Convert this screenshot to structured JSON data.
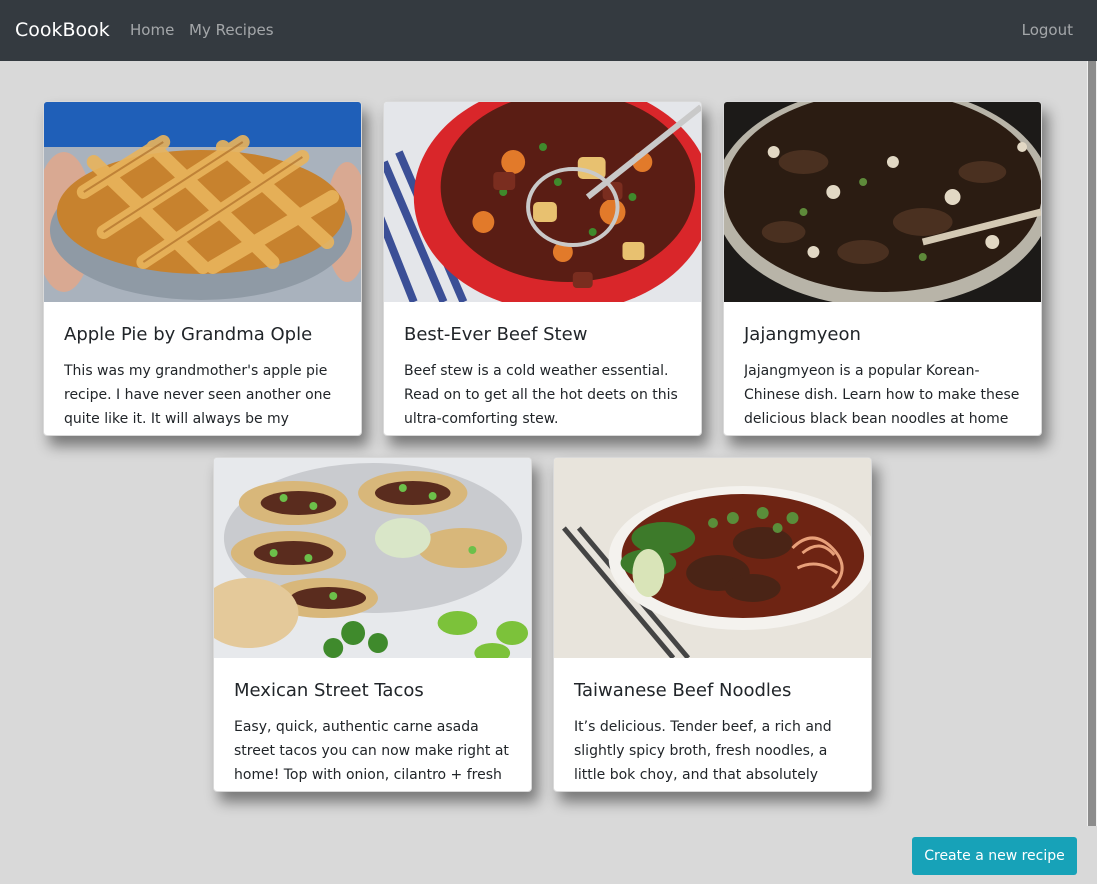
{
  "navbar": {
    "brand": "CookBook",
    "links": [
      "Home",
      "My Recipes"
    ],
    "logout": "Logout"
  },
  "recipes": [
    {
      "title": "Apple Pie by Grandma Ople",
      "description": "This was my grandmother's apple pie recipe. I have never seen another one quite like it. It will always be my",
      "image": "apple-pie-photo"
    },
    {
      "title": "Best-Ever Beef Stew",
      "description": "Beef stew is a cold weather essential. Read on to get all the hot deets on this ultra-comforting stew.",
      "image": "beef-stew-photo"
    },
    {
      "title": "Jajangmyeon",
      "description": "Jajangmyeon is a popular Korean-Chinese dish. Learn how to make these delicious black bean noodles at home",
      "image": "jajangmyeon-photo"
    },
    {
      "title": "Mexican Street Tacos",
      "description": "Easy, quick, authentic carne asada street tacos you can now make right at home! Top with onion, cilantro + fresh",
      "image": "street-tacos-photo"
    },
    {
      "title": "Taiwanese Beef Noodles",
      "description": "It’s delicious. Tender beef, a rich and slightly spicy broth, fresh noodles, a little bok choy, and that absolutely",
      "image": "beef-noodles-photo"
    }
  ],
  "actions": {
    "create_label": "Create a new recipe"
  },
  "colors": {
    "navbar": "#343a40",
    "background": "#d9d9d9",
    "button": "#17a2b8"
  }
}
